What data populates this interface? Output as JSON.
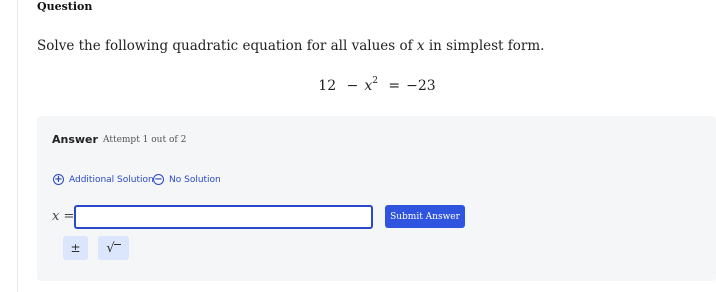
{
  "question": {
    "title": "Question",
    "prompt_before": "Solve the following quadratic equation for all values of ",
    "prompt_var": "x",
    "prompt_after": " in simplest form.",
    "equation": {
      "lhs_const": "12",
      "minus": "−",
      "var": "x",
      "exponent": "2",
      "equals": "=",
      "rhs": "−23"
    }
  },
  "answer": {
    "title": "Answer",
    "attempt_text": "Attempt 1 out of 2",
    "additional_solution_label": "Additional Solution",
    "no_solution_label": "No Solution",
    "input_label_var": "x",
    "input_label_eq": "=",
    "input_value": "",
    "submit_label": "Submit Answer",
    "keys": {
      "plus_minus": "±",
      "sqrt": "√"
    }
  },
  "colors": {
    "accent": "#2f55e0",
    "panel_bg": "#f4f6f8",
    "key_bg": "#dbe5fb"
  }
}
